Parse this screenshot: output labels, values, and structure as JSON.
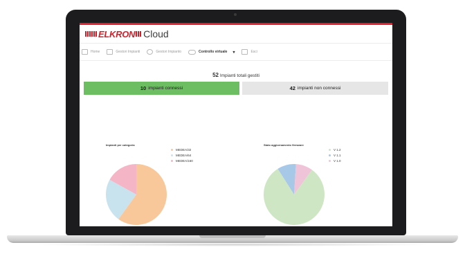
{
  "app": {
    "logo_text": "ELKRON",
    "title_suffix": "Cloud"
  },
  "nav": {
    "items": [
      {
        "label": "Home",
        "icon": "home-icon"
      },
      {
        "label": "Gestori Impianti",
        "icon": "list-icon"
      },
      {
        "label": "Gestori Impianto",
        "icon": "gear-icon"
      },
      {
        "label": "Controllo virtuale",
        "icon": "cloud-icon",
        "active": true
      },
      {
        "label": "Esci",
        "icon": "logout-icon"
      }
    ]
  },
  "summary": {
    "total_count": "52",
    "total_label": "Impianti totali gestiti",
    "connected_count": "10",
    "connected_label": "impianti connessi",
    "not_connected_count": "42",
    "not_connected_label": "impianti non connessi"
  },
  "chart_data": [
    {
      "type": "pie",
      "title": "Impianti per categoria",
      "legend_position": "right",
      "categories": [
        "MEDEA/32",
        "MEDEA/64",
        "MEDEA/160"
      ],
      "values": [
        60,
        23,
        17
      ],
      "colors": [
        "#f9c89a",
        "#c9e3ee",
        "#f4b6c6"
      ]
    },
    {
      "type": "pie",
      "title": "Stato aggiornamento firmware",
      "legend_position": "right",
      "categories": [
        "V 1.2",
        "V 1.1",
        "V 1.0"
      ],
      "values": [
        81,
        10,
        9
      ],
      "colors": [
        "#cfe6c4",
        "#a8c8e8",
        "#f0c4d8"
      ]
    }
  ],
  "colors": {
    "brand_red": "#e4202e",
    "connected_green": "#6dbd63",
    "not_connected_gray": "#e6e6e6"
  }
}
